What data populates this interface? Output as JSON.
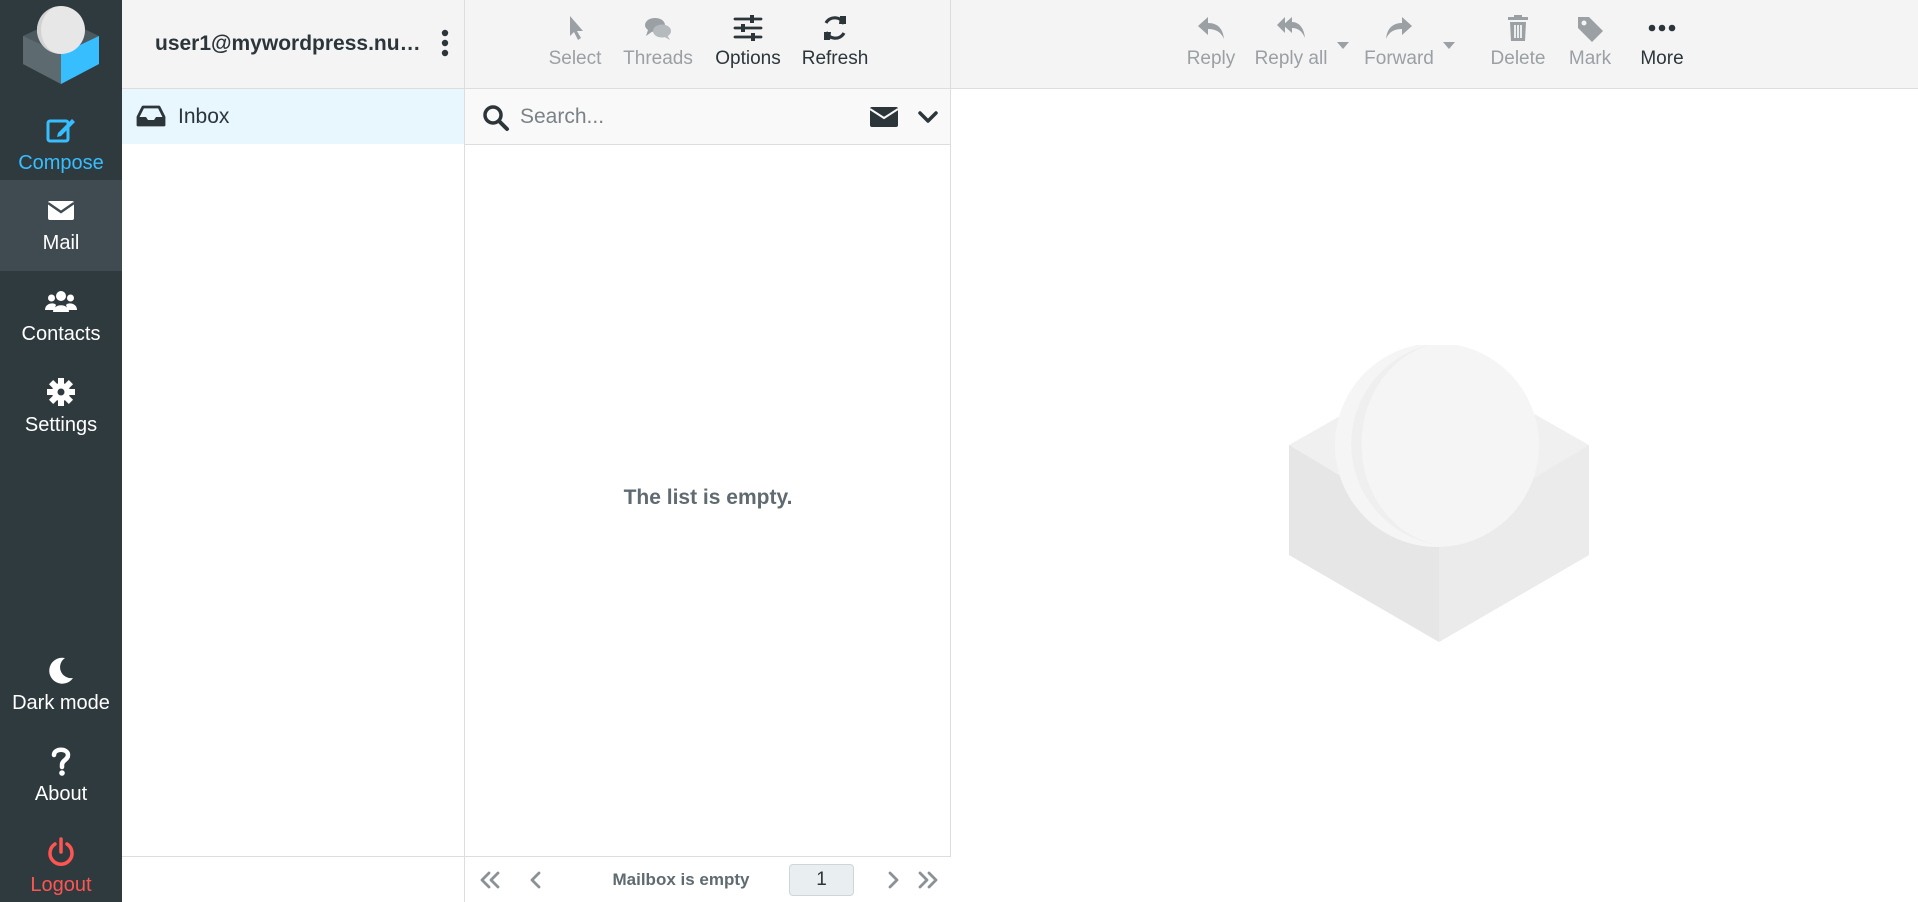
{
  "nav": {
    "compose": "Compose",
    "mail": "Mail",
    "contacts": "Contacts",
    "settings": "Settings",
    "dark_mode": "Dark mode",
    "about": "About",
    "logout": "Logout"
  },
  "account": {
    "email": "user1@mywordpress.nuri..."
  },
  "folders": [
    {
      "label": "Inbox",
      "icon": "inbox-icon"
    }
  ],
  "list_toolbar": {
    "select": "Select",
    "threads": "Threads",
    "options": "Options",
    "refresh": "Refresh"
  },
  "search": {
    "placeholder": "Search..."
  },
  "list": {
    "empty_message": "The list is empty."
  },
  "pager": {
    "status": "Mailbox is empty",
    "page": "1"
  },
  "preview_toolbar": {
    "reply": "Reply",
    "reply_all": "Reply all",
    "forward": "Forward",
    "delete": "Delete",
    "mark": "Mark",
    "more": "More"
  },
  "colors": {
    "nav_bg": "#2f3a3f",
    "accent": "#37beff",
    "logout": "#ff5552",
    "selected_folder": "#e8f6fd"
  }
}
